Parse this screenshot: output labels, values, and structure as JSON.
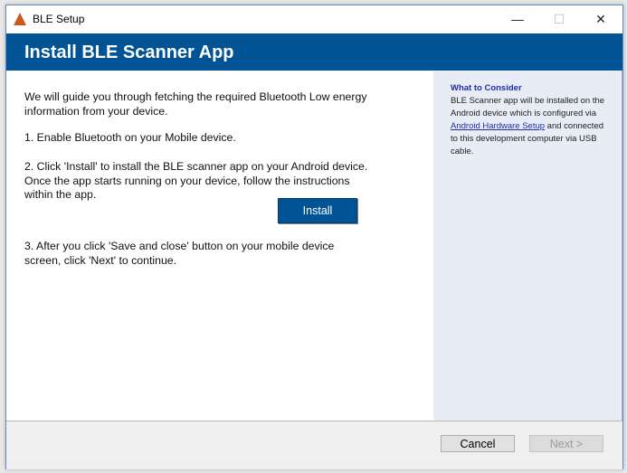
{
  "window": {
    "title": "BLE Setup",
    "minimize": "—",
    "maximize": "☐",
    "close": "✕"
  },
  "header": {
    "title": "Install BLE Scanner App"
  },
  "main": {
    "intro": "We will guide you through fetching the required Bluetooth Low energy information from your device.",
    "step1": "1. Enable Bluetooth on your Mobile device.",
    "step2": "2. Click 'Install' to install the BLE scanner app on your Android device. Once the app starts running on your device, follow the instructions within the app.",
    "install_label": "Install",
    "step3": "3. After you click 'Save and close' button on your mobile device screen, click 'Next' to continue."
  },
  "sidebar": {
    "heading": "What to Consider",
    "text_before": "BLE Scanner app will be installed on the Android device which is configured via ",
    "link": "Android Hardware Setup",
    "text_after": " and connected to this development computer via USB cable."
  },
  "footer": {
    "cancel": "Cancel",
    "next": "Next >"
  }
}
